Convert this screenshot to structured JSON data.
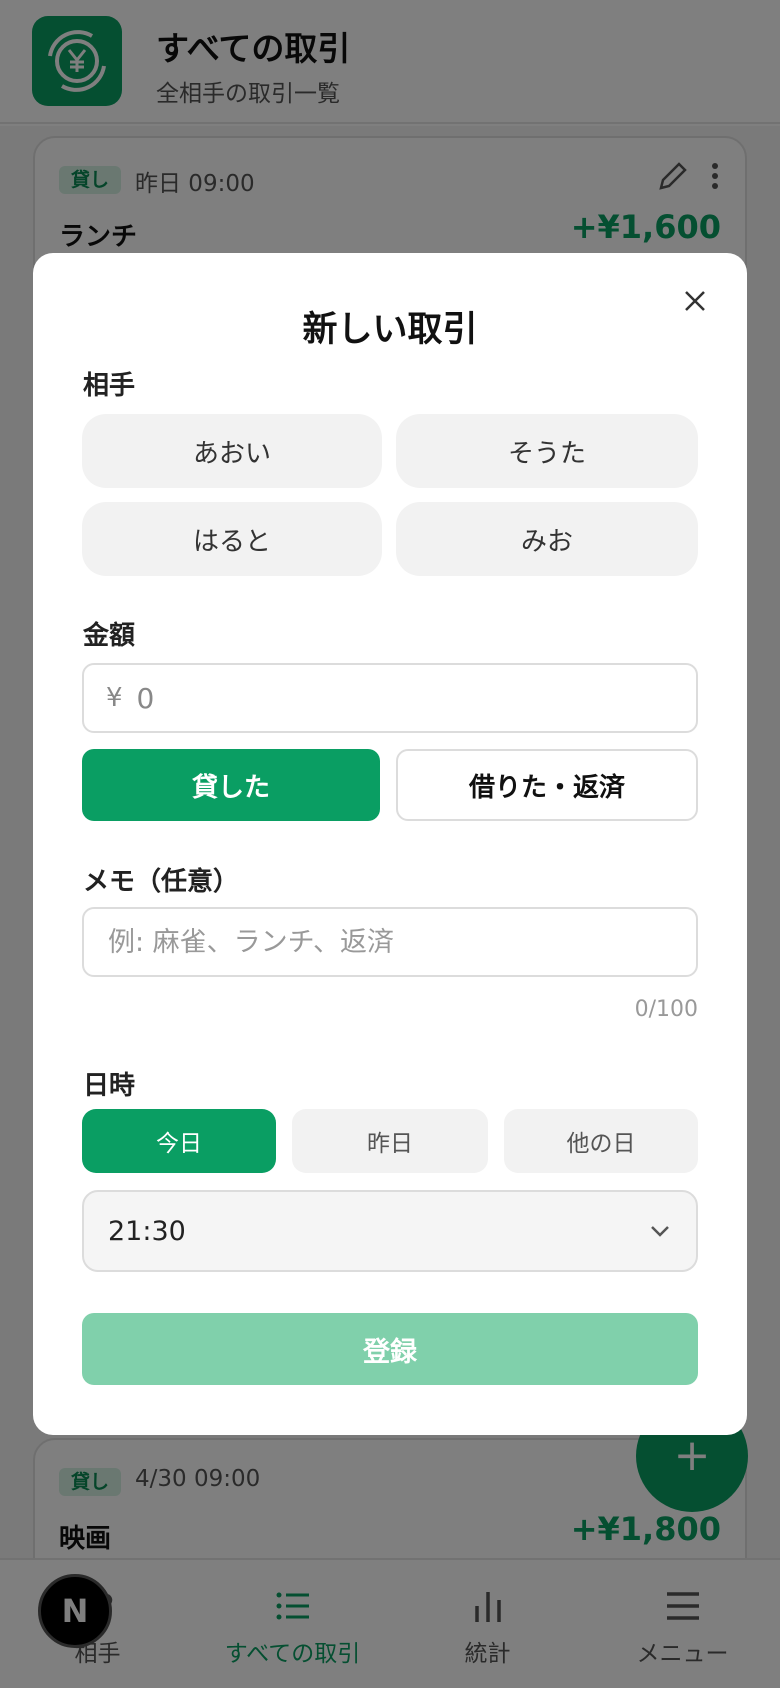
{
  "header": {
    "title": "すべての取引",
    "subtitle": "全相手の取引一覧"
  },
  "transactions": [
    {
      "badge": "貸し",
      "time": "昨日 09:00",
      "memo": "ランチ",
      "amount": "+¥1,600"
    },
    {
      "badge": "貸し",
      "time": "4/30 09:00",
      "memo": "映画",
      "amount": "+¥1,800"
    }
  ],
  "fab": {
    "label": "+"
  },
  "bottom_nav": [
    {
      "label": "相手",
      "icon": "people-icon",
      "active": false
    },
    {
      "label": "すべての取引",
      "icon": "list-icon",
      "active": true
    },
    {
      "label": "統計",
      "icon": "bar-chart-icon",
      "active": false
    },
    {
      "label": "メニュー",
      "icon": "menu-icon",
      "active": false
    }
  ],
  "dev_badge": {
    "label": "N"
  },
  "modal": {
    "title": "新しい取引",
    "partner_label": "相手",
    "partners": [
      "あおい",
      "そうた",
      "はると",
      "みお"
    ],
    "amount_label": "金額",
    "currency_symbol": "¥",
    "amount_value": "0",
    "type_options": [
      "貸した",
      "借りた・返済"
    ],
    "memo_label": "メモ（任意）",
    "memo_placeholder": "例: 麻雀、ランチ、返済",
    "memo_count": "0/100",
    "datetime_label": "日時",
    "day_options": [
      "今日",
      "昨日",
      "他の日"
    ],
    "time_value": "21:30",
    "submit_label": "登録"
  },
  "colors": {
    "accent": "#0a9e63",
    "accent_disabled": "#80d0ab"
  }
}
